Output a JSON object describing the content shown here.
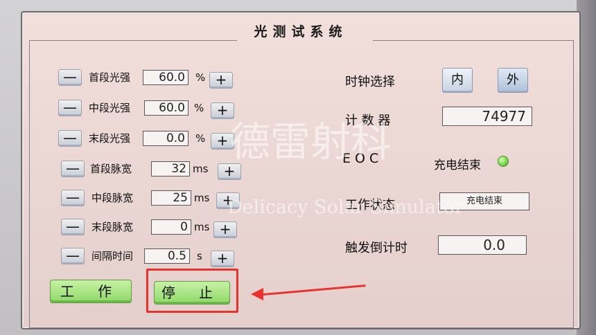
{
  "title": "光测试系统",
  "left_rows": [
    {
      "label": "首段光强",
      "value": "60.0",
      "unit": "%"
    },
    {
      "label": "中段光强",
      "value": "60.0",
      "unit": "%"
    },
    {
      "label": "末段光强",
      "value": "0.0",
      "unit": "%"
    },
    {
      "label": "首段脉宽",
      "value": "32",
      "unit": "ms"
    },
    {
      "label": "中段脉宽",
      "value": "25",
      "unit": "ms"
    },
    {
      "label": "末段脉宽",
      "value": "0",
      "unit": "ms"
    },
    {
      "label": "间隔时间",
      "value": "0.5",
      "unit": "s"
    }
  ],
  "controls": {
    "minus": "—",
    "plus": "+"
  },
  "clock": {
    "label": "时钟选择",
    "inner": "内",
    "outer": "外"
  },
  "counter": {
    "label": "计 数 器",
    "value": "74977"
  },
  "eoc": {
    "label": "E O C",
    "status": "充电结束",
    "led_color": "#77d84c"
  },
  "work_state": {
    "label": "工作状态",
    "value": "充电结束"
  },
  "trigger": {
    "label": "触发倒计时",
    "value": "0.0"
  },
  "buttons": {
    "work": "工 作",
    "stop": "停 止"
  },
  "watermark": {
    "cn": "德雷射科",
    "en": "Delicacy Solar Simulator"
  },
  "colors": {
    "highlight": "#e8322e",
    "button_green": "#8fd868"
  }
}
